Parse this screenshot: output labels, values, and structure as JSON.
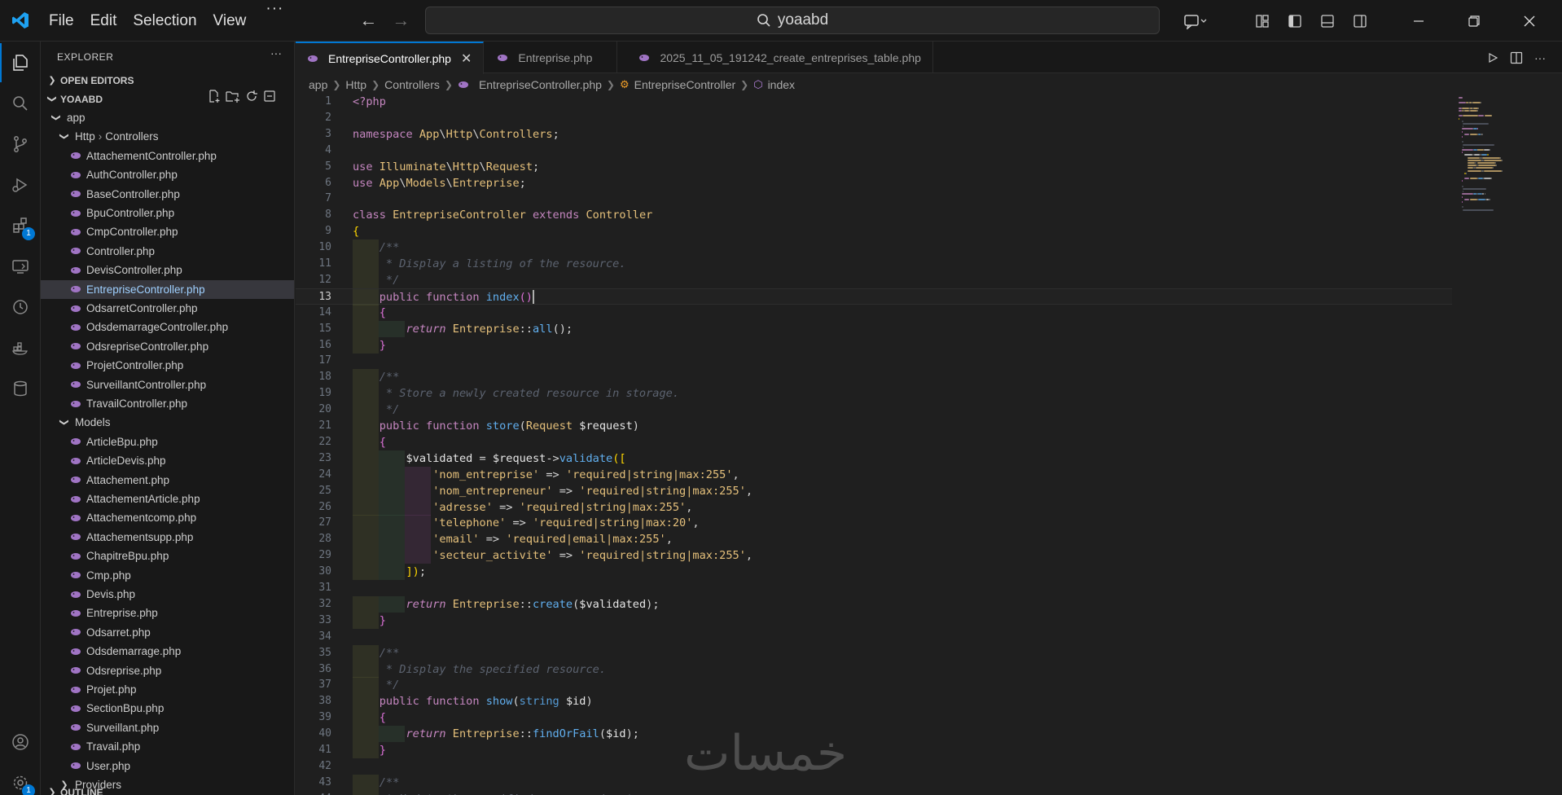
{
  "titlebar": {
    "menu": [
      "File",
      "Edit",
      "Selection",
      "View"
    ],
    "more": "···",
    "search": "yoaabd",
    "back": "←",
    "forward": "→"
  },
  "activity": {
    "extensions_badge": "1",
    "settings_badge": "1"
  },
  "sidebar": {
    "title": "EXPLORER",
    "more": "···",
    "open_editors": "OPEN EDITORS",
    "workspace": "YOAABD",
    "outline": "OUTLINE",
    "tree": [
      {
        "label": "app",
        "type": "folder",
        "depth": 1,
        "open": true
      },
      {
        "label": "Http",
        "sep": "›",
        "label2": "Controllers",
        "type": "folder",
        "depth": 2,
        "open": true
      },
      {
        "label": "AttachementController.php",
        "type": "php",
        "depth": 3
      },
      {
        "label": "AuthController.php",
        "type": "php",
        "depth": 3
      },
      {
        "label": "BaseController.php",
        "type": "php",
        "depth": 3
      },
      {
        "label": "BpuController.php",
        "type": "php",
        "depth": 3
      },
      {
        "label": "CmpController.php",
        "type": "php",
        "depth": 3
      },
      {
        "label": "Controller.php",
        "type": "php",
        "depth": 3
      },
      {
        "label": "DevisController.php",
        "type": "php",
        "depth": 3
      },
      {
        "label": "EntrepriseController.php",
        "type": "php",
        "depth": 3,
        "selected": true
      },
      {
        "label": "OdsarretController.php",
        "type": "php",
        "depth": 3
      },
      {
        "label": "OdsdemarrageController.php",
        "type": "php",
        "depth": 3
      },
      {
        "label": "OdsrepriseController.php",
        "type": "php",
        "depth": 3
      },
      {
        "label": "ProjetController.php",
        "type": "php",
        "depth": 3
      },
      {
        "label": "SurveillantController.php",
        "type": "php",
        "depth": 3
      },
      {
        "label": "TravailController.php",
        "type": "php",
        "depth": 3
      },
      {
        "label": "Models",
        "type": "folder",
        "depth": 2,
        "open": true
      },
      {
        "label": "ArticleBpu.php",
        "type": "php",
        "depth": 3
      },
      {
        "label": "ArticleDevis.php",
        "type": "php",
        "depth": 3
      },
      {
        "label": "Attachement.php",
        "type": "php",
        "depth": 3
      },
      {
        "label": "AttachementArticle.php",
        "type": "php",
        "depth": 3
      },
      {
        "label": "Attachementcomp.php",
        "type": "php",
        "depth": 3
      },
      {
        "label": "Attachementsupp.php",
        "type": "php",
        "depth": 3
      },
      {
        "label": "ChapitreBpu.php",
        "type": "php",
        "depth": 3
      },
      {
        "label": "Cmp.php",
        "type": "php",
        "depth": 3
      },
      {
        "label": "Devis.php",
        "type": "php",
        "depth": 3
      },
      {
        "label": "Entreprise.php",
        "type": "php",
        "depth": 3
      },
      {
        "label": "Odsarret.php",
        "type": "php",
        "depth": 3
      },
      {
        "label": "Odsdemarrage.php",
        "type": "php",
        "depth": 3
      },
      {
        "label": "Odsreprise.php",
        "type": "php",
        "depth": 3
      },
      {
        "label": "Projet.php",
        "type": "php",
        "depth": 3
      },
      {
        "label": "SectionBpu.php",
        "type": "php",
        "depth": 3
      },
      {
        "label": "Surveillant.php",
        "type": "php",
        "depth": 3
      },
      {
        "label": "Travail.php",
        "type": "php",
        "depth": 3
      },
      {
        "label": "User.php",
        "type": "php",
        "depth": 3
      },
      {
        "label": "Providers",
        "type": "folder",
        "depth": 2,
        "open": false
      }
    ]
  },
  "editor": {
    "tabs": [
      {
        "label": "EntrepriseController.php",
        "active": true,
        "close": "✕"
      },
      {
        "label": "Entreprise.php",
        "active": false
      },
      {
        "label": "2025_11_05_191242_create_entreprises_table.php",
        "active": false
      }
    ],
    "breadcrumb": [
      "app",
      "Http",
      "Controllers",
      "EntrepriseController.php",
      "EntrepriseController",
      "index"
    ],
    "current_line": 13,
    "lines": [
      [
        [
          "tag",
          "<?php"
        ]
      ],
      [],
      [
        [
          "kw",
          "namespace "
        ],
        [
          "cls",
          "App"
        ],
        [
          "op",
          "\\"
        ],
        [
          "cls",
          "Http"
        ],
        [
          "op",
          "\\"
        ],
        [
          "cls",
          "Controllers"
        ],
        [
          "op",
          ";"
        ]
      ],
      [],
      [
        [
          "kw",
          "use "
        ],
        [
          "cls",
          "Illuminate"
        ],
        [
          "op",
          "\\"
        ],
        [
          "cls",
          "Http"
        ],
        [
          "op",
          "\\"
        ],
        [
          "cls",
          "Request"
        ],
        [
          "op",
          ";"
        ]
      ],
      [
        [
          "kw",
          "use "
        ],
        [
          "cls",
          "App"
        ],
        [
          "op",
          "\\"
        ],
        [
          "cls",
          "Models"
        ],
        [
          "op",
          "\\"
        ],
        [
          "cls",
          "Entreprise"
        ],
        [
          "op",
          ";"
        ]
      ],
      [],
      [
        [
          "kw",
          "class "
        ],
        [
          "cls",
          "EntrepriseController "
        ],
        [
          "kw",
          "extends "
        ],
        [
          "cls",
          "Controller"
        ]
      ],
      [
        [
          "par",
          "{"
        ]
      ],
      [
        [
          "cmt",
          "    /**"
        ]
      ],
      [
        [
          "cmt",
          "     * Display a listing of the resource."
        ]
      ],
      [
        [
          "cmt",
          "     */"
        ]
      ],
      [
        [
          "op",
          "    "
        ],
        [
          "kw",
          "public function "
        ],
        [
          "fn",
          "index"
        ],
        [
          "par2",
          "()"
        ],
        [
          "cursor",
          ""
        ]
      ],
      [
        [
          "op",
          "    "
        ],
        [
          "par2",
          "{"
        ]
      ],
      [
        [
          "op",
          "        "
        ],
        [
          "ret",
          "return "
        ],
        [
          "cls",
          "Entreprise"
        ],
        [
          "op",
          "::"
        ],
        [
          "fn",
          "all"
        ],
        [
          "op",
          "();"
        ]
      ],
      [
        [
          "op",
          "    "
        ],
        [
          "par2",
          "}"
        ]
      ],
      [],
      [
        [
          "cmt",
          "    /**"
        ]
      ],
      [
        [
          "cmt",
          "     * Store a newly created resource in storage."
        ]
      ],
      [
        [
          "cmt",
          "     */"
        ]
      ],
      [
        [
          "op",
          "    "
        ],
        [
          "kw",
          "public function "
        ],
        [
          "fn",
          "store"
        ],
        [
          "op",
          "("
        ],
        [
          "cls",
          "Request "
        ],
        [
          "var",
          "$request"
        ],
        [
          "op",
          ")"
        ]
      ],
      [
        [
          "op",
          "    "
        ],
        [
          "par2",
          "{"
        ]
      ],
      [
        [
          "op",
          "        "
        ],
        [
          "var",
          "$validated "
        ],
        [
          "op",
          "= "
        ],
        [
          "var",
          "$request"
        ],
        [
          "op",
          "->"
        ],
        [
          "fn",
          "validate"
        ],
        [
          "par",
          "(["
        ]
      ],
      [
        [
          "op",
          "            "
        ],
        [
          "str",
          "'nom_entreprise' "
        ],
        [
          "op",
          "=> "
        ],
        [
          "str",
          "'required|string|max:255'"
        ],
        [
          "op",
          ","
        ]
      ],
      [
        [
          "op",
          "            "
        ],
        [
          "str",
          "'nom_entrepreneur' "
        ],
        [
          "op",
          "=> "
        ],
        [
          "str",
          "'required|string|max:255'"
        ],
        [
          "op",
          ","
        ]
      ],
      [
        [
          "op",
          "            "
        ],
        [
          "str",
          "'adresse' "
        ],
        [
          "op",
          "=> "
        ],
        [
          "str",
          "'required|string|max:255'"
        ],
        [
          "op",
          ","
        ]
      ],
      [
        [
          "op",
          "            "
        ],
        [
          "str",
          "'telephone' "
        ],
        [
          "op",
          "=> "
        ],
        [
          "str",
          "'required|string|max:20'"
        ],
        [
          "op",
          ","
        ]
      ],
      [
        [
          "op",
          "            "
        ],
        [
          "str",
          "'email' "
        ],
        [
          "op",
          "=> "
        ],
        [
          "str",
          "'required|email|max:255'"
        ],
        [
          "op",
          ","
        ]
      ],
      [
        [
          "op",
          "            "
        ],
        [
          "str",
          "'secteur_activite' "
        ],
        [
          "op",
          "=> "
        ],
        [
          "str",
          "'required|string|max:255'"
        ],
        [
          "op",
          ","
        ]
      ],
      [
        [
          "op",
          "        "
        ],
        [
          "par",
          "])"
        ],
        [
          "op",
          ";"
        ]
      ],
      [],
      [
        [
          "op",
          "        "
        ],
        [
          "ret",
          "return "
        ],
        [
          "cls",
          "Entreprise"
        ],
        [
          "op",
          "::"
        ],
        [
          "fn",
          "create"
        ],
        [
          "op",
          "("
        ],
        [
          "var",
          "$validated"
        ],
        [
          "op",
          ");"
        ]
      ],
      [
        [
          "op",
          "    "
        ],
        [
          "par2",
          "}"
        ]
      ],
      [],
      [
        [
          "cmt",
          "    /**"
        ]
      ],
      [
        [
          "cmt",
          "     * Display the specified resource."
        ]
      ],
      [
        [
          "cmt",
          "     */"
        ]
      ],
      [
        [
          "op",
          "    "
        ],
        [
          "kw",
          "public function "
        ],
        [
          "fn",
          "show"
        ],
        [
          "op",
          "("
        ],
        [
          "kw2",
          "string "
        ],
        [
          "var",
          "$id"
        ],
        [
          "op",
          ")"
        ]
      ],
      [
        [
          "op",
          "    "
        ],
        [
          "par2",
          "{"
        ]
      ],
      [
        [
          "op",
          "        "
        ],
        [
          "ret",
          "return "
        ],
        [
          "cls",
          "Entreprise"
        ],
        [
          "op",
          "::"
        ],
        [
          "fn",
          "findOrFail"
        ],
        [
          "op",
          "("
        ],
        [
          "var",
          "$id"
        ],
        [
          "op",
          ");"
        ]
      ],
      [
        [
          "op",
          "    "
        ],
        [
          "par2",
          "}"
        ]
      ],
      [],
      [
        [
          "cmt",
          "    /**"
        ]
      ],
      [
        [
          "cmt",
          "     * Update the specified resource in storage."
        ]
      ]
    ]
  },
  "watermark": "خمسات",
  "colors": {
    "accent": "#0078d4",
    "background": "#1f1f1f",
    "sidebar": "#181818",
    "selected_file": "#9fd0ff"
  }
}
